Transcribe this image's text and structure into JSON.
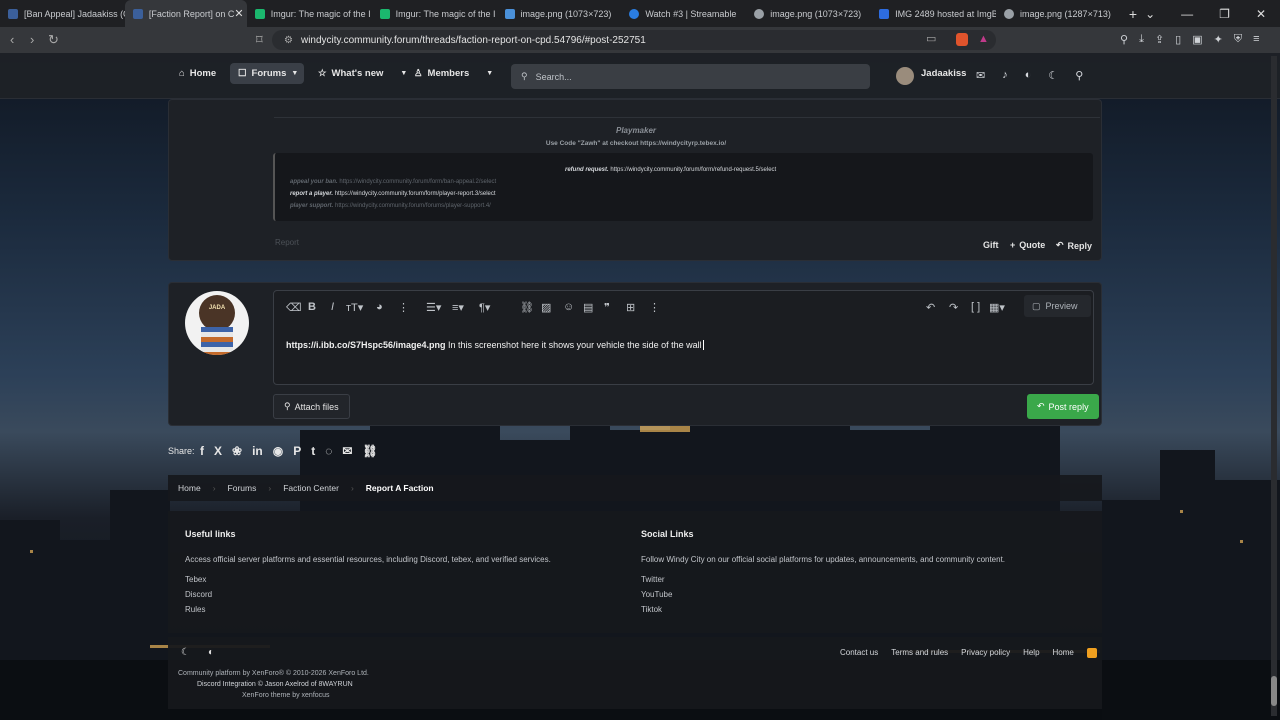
{
  "browser": {
    "tabs": [
      {
        "title": "[Ban Appeal] Jadaakiss (G",
        "color": "#3b5f9a"
      },
      {
        "title": "[Faction Report] on C",
        "color": "#3b5f9a",
        "active": true
      },
      {
        "title": "Imgur: The magic of the I",
        "color": "#1bb76e"
      },
      {
        "title": "Imgur: The magic of the I",
        "color": "#1bb76e"
      },
      {
        "title": "image.png (1073×723)",
        "color": "#4a90d9"
      },
      {
        "title": "Watch #3 | Streamable",
        "color": "#2a7de1"
      },
      {
        "title": "image.png (1073×723)",
        "color": "#9aa0a6"
      },
      {
        "title": "IMG 2489 hosted at ImgB",
        "color": "#2d6cdf"
      },
      {
        "title": "image.png (1287×713)",
        "color": "#9aa0a6"
      }
    ],
    "url": "windycity.community.forum/threads/faction-report-on-cpd.54796/#post-252751"
  },
  "nav": {
    "home": "Home",
    "forums": "Forums",
    "whats_new": "What's new",
    "members": "Members",
    "search_placeholder": "Search...",
    "username": "Jadaakiss"
  },
  "post": {
    "sig_name": "Playmaker",
    "sig_code": "Use Code \"Zawh\" at checkout https://windycityrp.tebex.io/",
    "refund_label": "refund request.",
    "refund_url": "https://windycity.community.forum/form/refund-request.5/select",
    "appeal_label": "appeal your ban.",
    "appeal_url": "https://windycity.community.forum/form/ban-appeal.2/select",
    "report_label": "report a player.",
    "report_url": "https://windycity.community.forum/form/player-report.3/select",
    "support_label": "player support.",
    "support_url": "https://windycity.community.forum/forums/player-support.4/",
    "report_btn": "Report",
    "gift_btn": "Gift",
    "quote_btn": "Quote",
    "reply_btn": "Reply"
  },
  "editor": {
    "link": "https://i.ibb.co/S7Hspc56/image4.png",
    "text": " In this screenshot here it shows your vehicle the side of the wall",
    "preview": "Preview",
    "attach": "Attach files",
    "post_reply": "Post reply",
    "avatar_text": "JADA"
  },
  "share": {
    "label": "Share:"
  },
  "breadcrumb": [
    "Home",
    "Forums",
    "Faction Center",
    "Report A Faction"
  ],
  "footer": {
    "useful_title": "Useful links",
    "useful_desc": "Access official server platforms and essential resources, including Discord, tebex, and verified services.",
    "useful_links": [
      "Tebex",
      "Discord",
      "Rules"
    ],
    "social_title": "Social Links",
    "social_desc": "Follow Windy City on our official social platforms for updates, announcements, and community content.",
    "social_links": [
      "Twitter",
      "YouTube",
      "Tiktok"
    ],
    "bottom_links": [
      "Contact us",
      "Terms and rules",
      "Privacy policy",
      "Help",
      "Home"
    ],
    "credit1": "Community platform by XenForo® © 2010-2026 XenForo Ltd.",
    "credit2": "Discord Integration © Jason Axelrod of 8WAYRUN",
    "credit3": "XenForo theme by xenfocus"
  },
  "colors": {
    "accent_green": "#3aa84a",
    "bg_card": "#1e2126"
  }
}
